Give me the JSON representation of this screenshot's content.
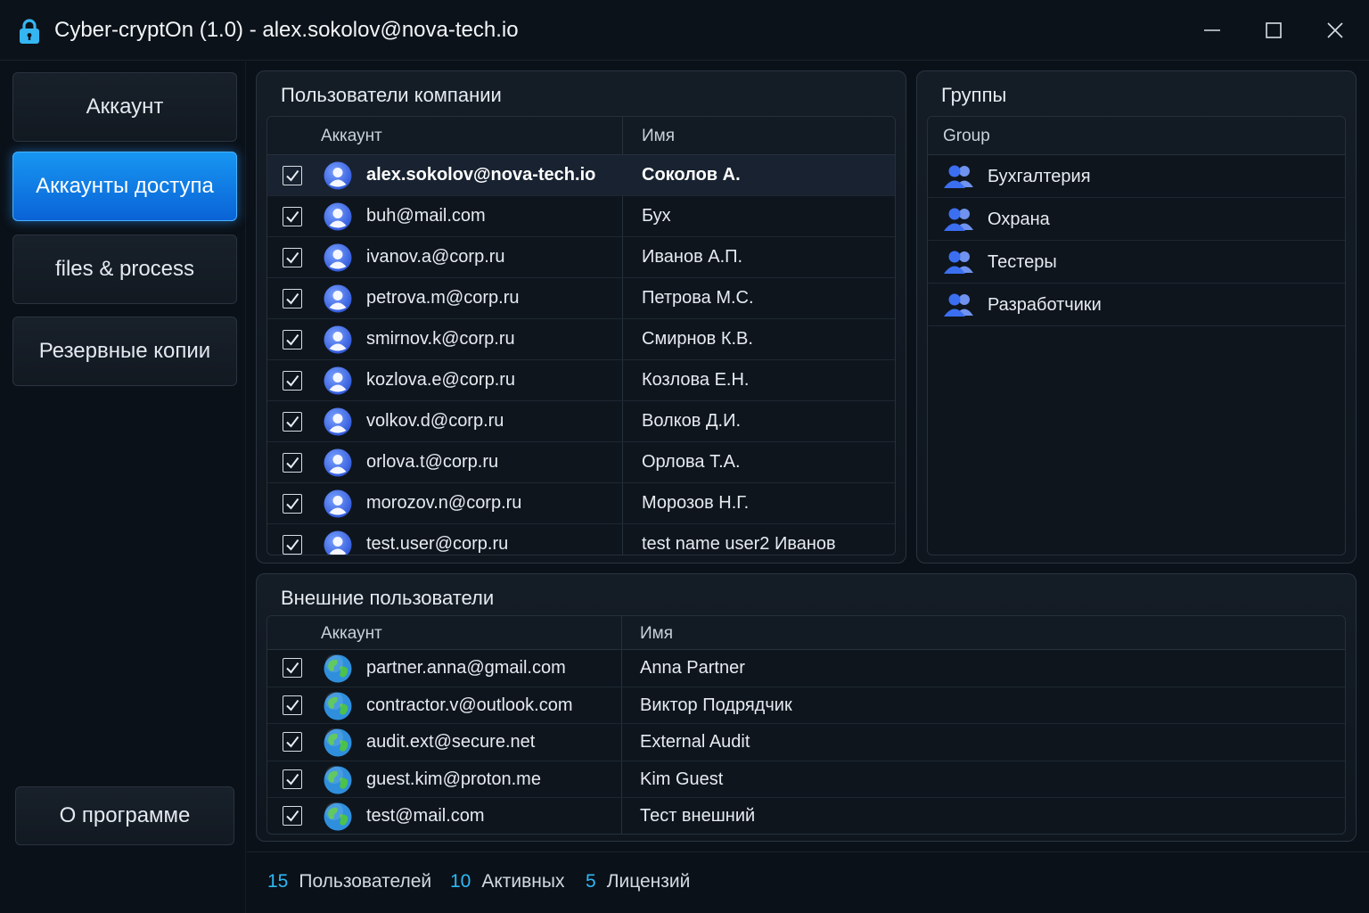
{
  "window": {
    "title": "Cyber-cryptOn (1.0) - alex.sokolov@nova-tech.io",
    "icons": {
      "app": "lock-icon",
      "minimize": "minimize-icon",
      "maximize": "maximize-icon",
      "close": "close-icon"
    }
  },
  "sidebar": {
    "items": [
      {
        "label": "Аккаунт",
        "active": false
      },
      {
        "label": "Аккаунты доступа",
        "active": true
      },
      {
        "label": "files & process",
        "active": false
      },
      {
        "label": "Резервные копии",
        "active": false
      }
    ],
    "about_label": "О программе"
  },
  "company_users": {
    "title": "Пользователи компании",
    "columns": {
      "account": "Аккаунт",
      "name": "Имя"
    },
    "rows": [
      {
        "account": "alex.sokolov@nova-tech.io",
        "name": "Соколов А.",
        "checked": true,
        "selected": true
      },
      {
        "account": "buh@mail.com",
        "name": "Бух",
        "checked": true
      },
      {
        "account": "ivanov.a@corp.ru",
        "name": "Иванов А.П.",
        "checked": true
      },
      {
        "account": "petrova.m@corp.ru",
        "name": "Петрова М.С.",
        "checked": true
      },
      {
        "account": "smirnov.k@corp.ru",
        "name": "Смирнов К.В.",
        "checked": true
      },
      {
        "account": "kozlova.e@corp.ru",
        "name": "Козлова Е.Н.",
        "checked": true
      },
      {
        "account": "volkov.d@corp.ru",
        "name": "Волков Д.И.",
        "checked": true
      },
      {
        "account": "orlova.t@corp.ru",
        "name": "Орлова Т.А.",
        "checked": true
      },
      {
        "account": "morozov.n@corp.ru",
        "name": "Морозов Н.Г.",
        "checked": true
      },
      {
        "account": "test.user@corp.ru",
        "name": "test name user2 Иванов",
        "checked": true
      }
    ],
    "row_icon": "user-avatar-icon"
  },
  "groups": {
    "title": "Группы",
    "column": "Group",
    "items": [
      {
        "label": "Бухгалтерия"
      },
      {
        "label": "Охрана"
      },
      {
        "label": "Тестеры"
      },
      {
        "label": "Разработчики"
      }
    ],
    "row_icon": "users-group-icon"
  },
  "external_users": {
    "title": "Внешние пользователи",
    "columns": {
      "account": "Аккаунт",
      "name": "Имя"
    },
    "rows": [
      {
        "account": "partner.anna@gmail.com",
        "name": "Anna Partner",
        "checked": true
      },
      {
        "account": "contractor.v@outlook.com",
        "name": "Виктор Подрядчик",
        "checked": true
      },
      {
        "account": "audit.ext@secure.net",
        "name": "External Audit",
        "checked": true
      },
      {
        "account": "guest.kim@proton.me",
        "name": "Kim Guest",
        "checked": true
      },
      {
        "account": "test@mail.com",
        "name": "Тест внешний",
        "checked": true
      }
    ],
    "row_icon": "globe-icon"
  },
  "status": {
    "users": {
      "value": "15",
      "label": "Пользователей"
    },
    "active": {
      "value": "10",
      "label": "Активных"
    },
    "licenses": {
      "value": "5",
      "label": "Лицензий"
    }
  },
  "colors": {
    "accent": "#1a8ff0",
    "status_number": "#2fb8f5",
    "background": "#0b1119"
  }
}
